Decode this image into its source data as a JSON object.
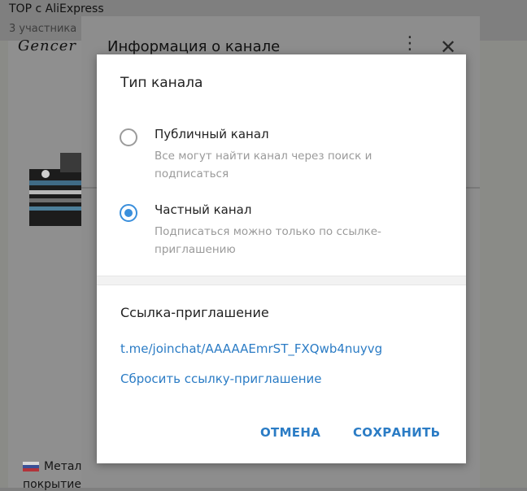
{
  "background": {
    "chat_title": "TOP с AliExpress",
    "chat_subtitle": "3 участника",
    "brand_text": "Gencer",
    "caption_line1": "Метал",
    "caption_line2": "покрытие"
  },
  "info_dialog": {
    "title": "Информация о канале",
    "menu_icon": "more-vertical-icon",
    "close_icon": "close-icon"
  },
  "modal": {
    "title": "Тип канала",
    "options": [
      {
        "label": "Публичный канал",
        "description": "Все могут найти канал через поиск и подписаться",
        "selected": false
      },
      {
        "label": "Частный канал",
        "description": "Подписаться можно только по ссылке-приглашению",
        "selected": true
      }
    ],
    "link_section_title": "Ссылка-приглашение",
    "invite_link": "t.me/joinchat/AAAAAEmrST_FXQwb4nuyvg",
    "reset_link_label": "Сбросить ссылку-приглашение",
    "cancel_label": "ОТМЕНА",
    "save_label": "СОХРАНИТЬ"
  },
  "colors": {
    "accent": "#2b7cc5",
    "radio_active": "#3a8fdc",
    "overlay": "#7f7f7f"
  }
}
